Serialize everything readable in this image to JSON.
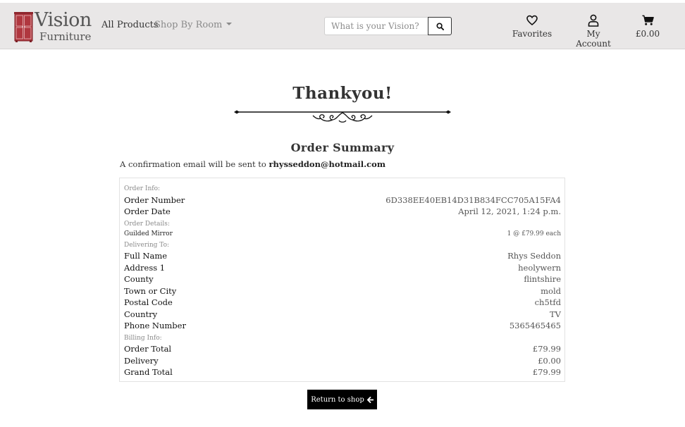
{
  "brand": {
    "name_top": "Vision",
    "name_bottom": "Furniture"
  },
  "nav": {
    "all_products": "All Products",
    "shop_by_room": "Shop By Room",
    "search_placeholder": "What is your Vision?",
    "favorites": "Favorites",
    "my_account": "My Account",
    "cart_total": "£0.00"
  },
  "icons": {
    "logo": "wardrobe-logo-icon",
    "search": "search-icon",
    "favorites": "heart-icon",
    "account": "user-icon",
    "cart": "cart-icon",
    "return": "arrow-left-icon",
    "divider": "ornamental-divider"
  },
  "colors": {
    "navbar_bg": "#e9e7e7",
    "logo_red": "#b0373f",
    "button_bg": "#000000"
  },
  "page": {
    "title": "Thankyou!",
    "summary_title": "Order Summary",
    "confirm_text": "A confirmation email will be sent to ",
    "email": "rhysseddon@hotmail.com"
  },
  "order": {
    "order_info_label": "Order Info:",
    "order_number_label": "Order Number",
    "order_number": "6D338EE40EB14D31B834FCC705A15FA4",
    "order_date_label": "Order Date",
    "order_date": "April 12, 2021, 1:24 p.m.",
    "order_details_label": "Order Details:",
    "item_name": "Guilded Mirror",
    "item_qty": "1 @ £79.99 each",
    "delivering_label": "Delivering To:",
    "full_name_label": "Full Name",
    "full_name": "Rhys Seddon",
    "address1_label": "Address 1",
    "address1": "heolywern",
    "county_label": "County",
    "county": "flintshire",
    "town_label": "Town or City",
    "town": "mold",
    "postal_label": "Postal Code",
    "postal": "ch5tfd",
    "country_label": "Country",
    "country": "TV",
    "phone_label": "Phone Number",
    "phone": "5365465465",
    "billing_label": "Billing Info:",
    "order_total_label": "Order Total",
    "order_total": "£79.99",
    "delivery_label": "Delivery",
    "delivery": "£0.00",
    "grand_total_label": "Grand Total",
    "grand_total": "£79.99"
  },
  "actions": {
    "return_label": "Return to shop"
  }
}
